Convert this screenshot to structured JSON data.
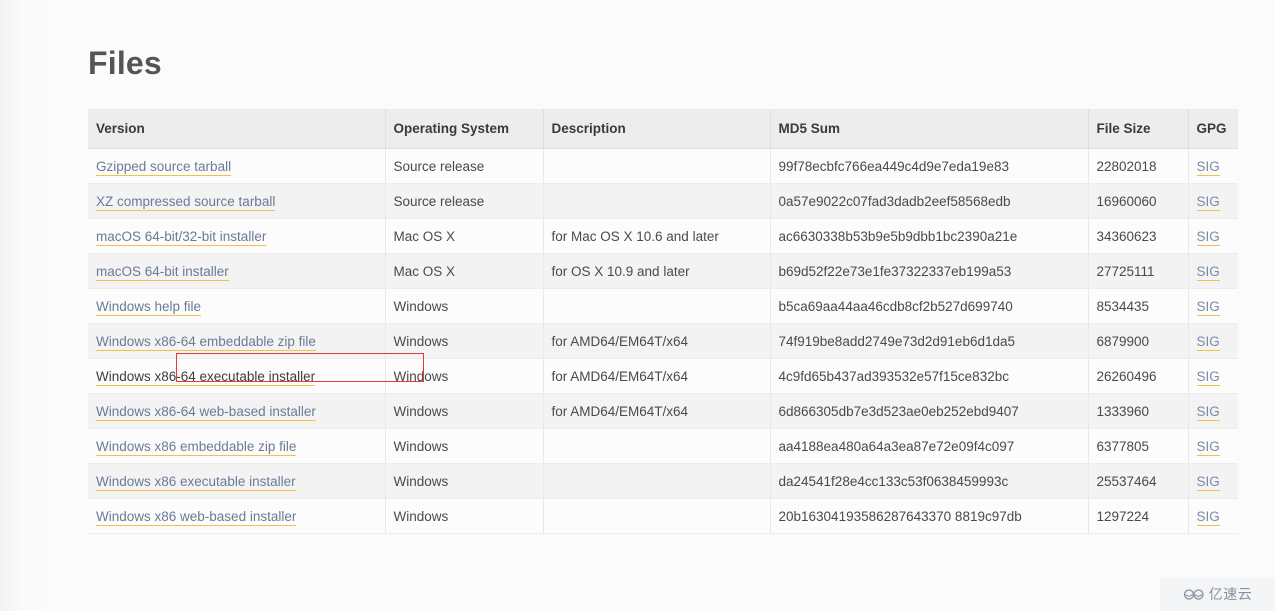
{
  "page": {
    "title": "Files",
    "accent_link_underline": "#f0c24b",
    "focus_outline_color": "#e03b3b",
    "header_bg": "#ededed",
    "link_color": "#6b7a96"
  },
  "table": {
    "columns": [
      "Version",
      "Operating System",
      "Description",
      "MD5 Sum",
      "File Size",
      "GPG"
    ],
    "gpg_label": "SIG",
    "rows": [
      {
        "version": "Gzipped source tarball",
        "os": "Source release",
        "description": "",
        "md5": "99f78ecbfc766ea449c4d9e7eda19e83",
        "size": "22802018",
        "gpg": "SIG",
        "focused": false
      },
      {
        "version": "XZ compressed source tarball",
        "os": "Source release",
        "description": "",
        "md5": "0a57e9022c07fad3dadb2eef58568edb",
        "size": "16960060",
        "gpg": "SIG",
        "focused": false
      },
      {
        "version": "macOS 64-bit/32-bit installer",
        "os": "Mac OS X",
        "description": "for Mac OS X 10.6 and later",
        "md5": "ac6630338b53b9e5b9dbb1bc2390a21e",
        "size": "34360623",
        "gpg": "SIG",
        "focused": false
      },
      {
        "version": "macOS 64-bit installer",
        "os": "Mac OS X",
        "description": "for OS X 10.9 and later",
        "md5": "b69d52f22e73e1fe37322337eb199a53",
        "size": "27725111",
        "gpg": "SIG",
        "focused": false
      },
      {
        "version": "Windows help file",
        "os": "Windows",
        "description": "",
        "md5": "b5ca69aa44aa46cdb8cf2b527d699740",
        "size": "8534435",
        "gpg": "SIG",
        "focused": false
      },
      {
        "version": "Windows x86-64 embeddable zip file",
        "os": "Windows",
        "description": "for AMD64/EM64T/x64",
        "md5": "74f919be8add2749e73d2d91eb6d1da5",
        "size": "6879900",
        "gpg": "SIG",
        "focused": false
      },
      {
        "version": "Windows x86-64 executable installer",
        "os": "Windows",
        "description": "for AMD64/EM64T/x64",
        "md5": "4c9fd65b437ad393532e57f15ce832bc",
        "size": "26260496",
        "gpg": "SIG",
        "focused": true
      },
      {
        "version": "Windows x86-64 web-based installer",
        "os": "Windows",
        "description": "for AMD64/EM64T/x64",
        "md5": "6d866305db7e3d523ae0eb252ebd9407",
        "size": "1333960",
        "gpg": "SIG",
        "focused": false
      },
      {
        "version": "Windows x86 embeddable zip file",
        "os": "Windows",
        "description": "",
        "md5": "aa4188ea480a64a3ea87e72e09f4c097",
        "size": "6377805",
        "gpg": "SIG",
        "focused": false
      },
      {
        "version": "Windows x86 executable installer",
        "os": "Windows",
        "description": "",
        "md5": "da24541f28e4cc133c53f0638459993c",
        "size": "25537464",
        "gpg": "SIG",
        "focused": false
      },
      {
        "version": "Windows x86 web-based installer",
        "os": "Windows",
        "description": "",
        "md5": "20b16304193586287643370 8819c97db",
        "size": "1297224",
        "gpg": "SIG",
        "focused": false
      }
    ]
  },
  "watermark": {
    "text": "亿速云",
    "logo": "cloud-logo-icon"
  }
}
